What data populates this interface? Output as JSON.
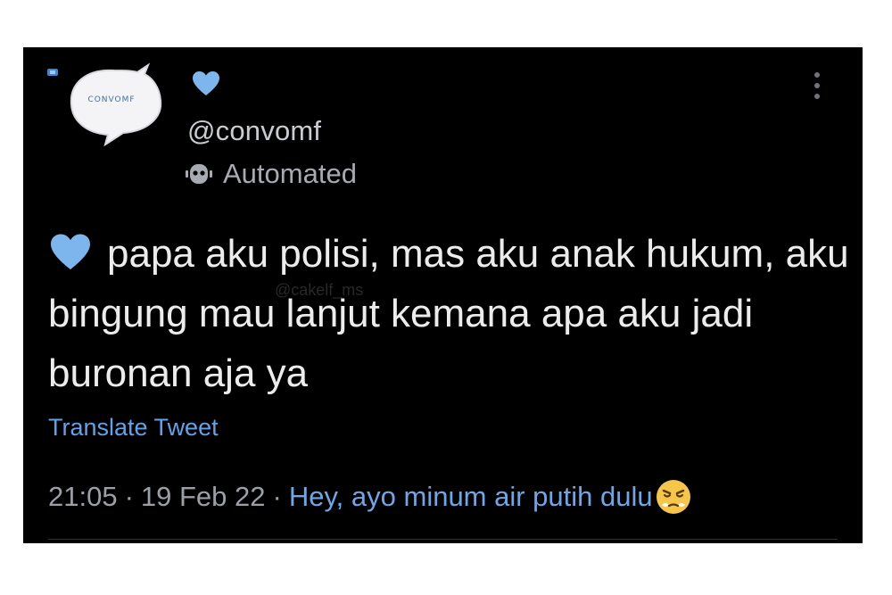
{
  "profile": {
    "avatar_text": "CONVOMF",
    "handle": "@convomf",
    "automated_label": "Automated"
  },
  "tweet": {
    "text": "papa aku polisi, mas aku anak hukum, aku bingung mau lanjut kemana apa aku jadi buronan aja ya",
    "watermark": "@cakelf_ms",
    "translate_label": "Translate Tweet",
    "time": "21:05",
    "separator": "·",
    "date": "19 Feb 22",
    "source": "Hey, ayo minum air putih dulu"
  },
  "icons": {
    "heart": "blue-heart-icon",
    "robot": "robot-icon",
    "more": "more-vertical-icon",
    "emoji": "angry-face-emoji-icon"
  },
  "colors": {
    "background": "#000000",
    "heart": "#7cb6ec",
    "link": "#5fa3e8",
    "text": "#ececec",
    "muted": "#9aa0a6"
  }
}
